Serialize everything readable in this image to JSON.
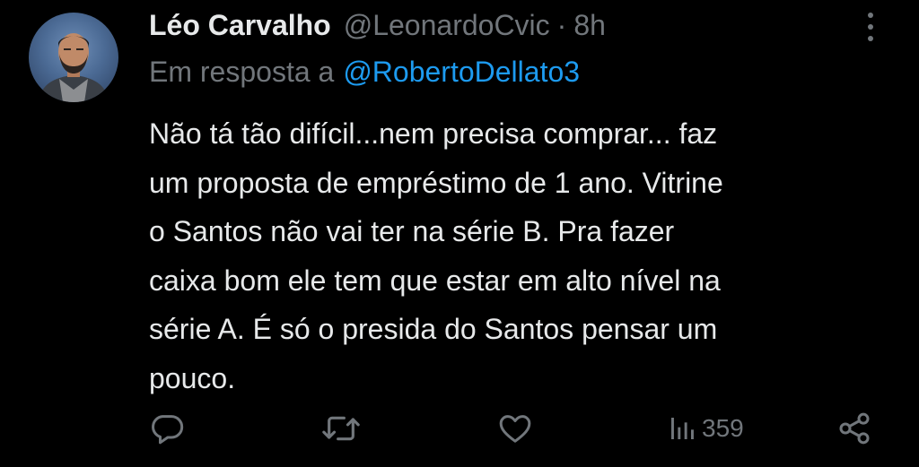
{
  "tweet": {
    "display_name": "Léo Carvalho",
    "handle": "@LeonardoCvic",
    "separator": "·",
    "time": "8h",
    "reply_prefix": "Em resposta a",
    "reply_to": "@RobertoDellato3",
    "lines": [
      "Não tá tão difícil...nem precisa comprar... faz",
      "um proposta de empréstimo de 1 ano. Vitrine",
      "o Santos não vai ter na série B. Pra fazer",
      "caixa bom ele tem que estar em alto nível na",
      "série A. É só o presida do Santos pensar um",
      "pouco."
    ]
  },
  "actions": {
    "reply_icon": "reply-icon",
    "retweet_icon": "retweet-icon",
    "like_icon": "heart-icon",
    "views_icon": "views-icon",
    "views_count": "359",
    "share_icon": "share-icon"
  },
  "colors": {
    "background": "#000000",
    "text": "#e7e9ea",
    "muted": "#71767b",
    "accent": "#1d9bf0"
  }
}
